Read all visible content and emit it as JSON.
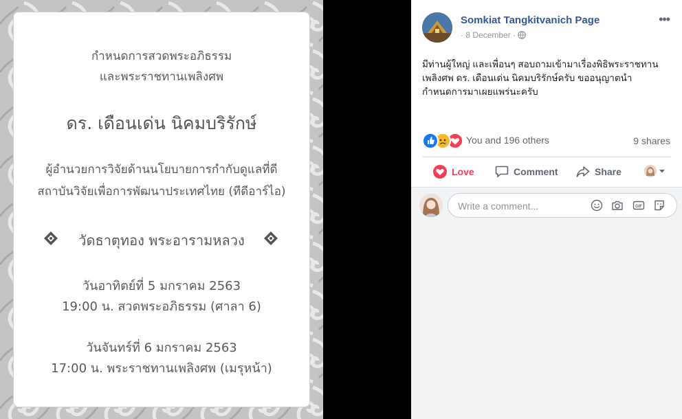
{
  "invitation": {
    "heading_line1": "กำหนดการสวดพระอภิธรรม",
    "heading_line2": "และพระราชทานเพลิงศพ",
    "deceased_name": "ดร. เดือนเด่น นิคมบริรักษ์",
    "role_line1": "ผู้อำนวยการวิจัยด้านนโยบายการกำกับดูแลที่ดี",
    "role_line2": "สถาบันวิจัยเพื่อการพัฒนาประเทศไทย (ทีดีอาร์ไอ)",
    "temple": "วัดธาตุทอง พระอารามหลวง",
    "day1_date": "วันอาทิตย์ที่ 5 มกราคม 2563",
    "day1_event": "19:00 น. สวดพระอภิธรรม (ศาลา 6)",
    "day2_date": "วันจันทร์ที่ 6 มกราคม 2563",
    "day2_event": "17:00 น. พระราชทานเพลิงศพ (เมรุหน้า)"
  },
  "post": {
    "page_name": "Somkiat Tangkitvanich Page",
    "date": "8 December",
    "separator": "·",
    "more_label": "•••",
    "text": "มีท่านผู้ใหญ่ และเพื่อนๆ สอบถามเข้ามาเรื่องพิธิพระราชทานเพลิงศพ ดร. เดือนเด่น นิคมบริรักษ์ครับ ขออนุญาตนำกำหนดการมาเผยแพร่นะครับ",
    "reaction_icons": [
      "like-icon",
      "sad-icon",
      "love-icon"
    ],
    "reaction_count": "You and 196 others",
    "shares": "9 shares"
  },
  "actions": {
    "love_label": "Love",
    "comment_label": "Comment",
    "share_label": "Share"
  },
  "composer": {
    "placeholder": "Write a comment...",
    "icons": [
      "emoji-icon",
      "camera-icon",
      "gif-icon",
      "sticker-icon"
    ]
  },
  "colors": {
    "link_blue": "#365899",
    "love_red": "#f33e58",
    "like_blue": "#1877f2",
    "sad_yellow": "#f7b928",
    "muted_gray": "#606770"
  }
}
